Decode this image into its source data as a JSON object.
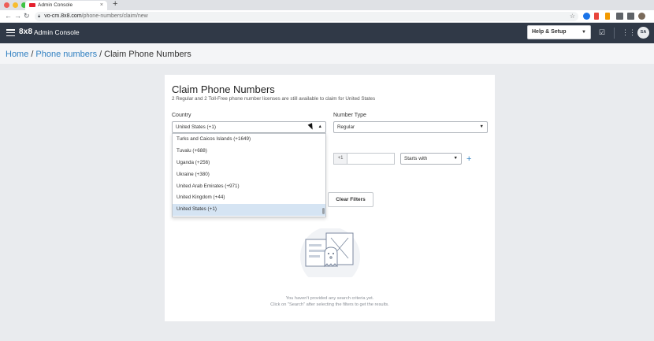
{
  "browser": {
    "tab_title": "Admin Console",
    "tab_close": "×",
    "new_tab": "+",
    "url_host": "vo-cm.8x8.com",
    "url_path": "/phone-numbers/claim/new",
    "back_icon": "←",
    "forward_icon": "→",
    "reload_icon": "↻",
    "star_icon": "☆"
  },
  "header": {
    "logo": "8x8",
    "app_name": "Admin Console",
    "help_label": "Help & Setup",
    "avatar_initials": "SA"
  },
  "breadcrumb": {
    "home": "Home",
    "phone_numbers": "Phone numbers",
    "current": "Claim Phone Numbers"
  },
  "form": {
    "title": "Claim Phone Numbers",
    "subtitle": "2 Regular and 2 Toll-Free phone number licenses are still available to claim for United States",
    "country_label": "Country",
    "country_value": "United States (+1)",
    "number_type_label": "Number Type",
    "number_type_value": "Regular",
    "country_code": "+1",
    "match_value": "Starts with",
    "clear_filters": "Clear Filters"
  },
  "dropdown": {
    "options": [
      "Turks and Caicos Islands (+1649)",
      "Tuvalu (+688)",
      "Uganda (+256)",
      "Ukraine (+380)",
      "United Arab Emirates (+971)",
      "United Kingdom (+44)",
      "United States (+1)"
    ],
    "selected_index": 6
  },
  "empty_state": {
    "line1": "You haven't provided any search criteria yet.",
    "line2": "Click on \"Search\" after selecting the filters to get the results."
  },
  "colors": {
    "header_bg": "#303947",
    "link": "#2f7fc1",
    "selected_option": "#d5e4f3"
  }
}
